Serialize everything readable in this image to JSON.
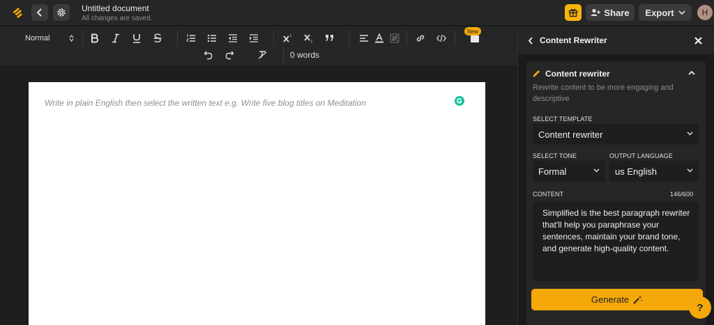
{
  "topbar": {
    "doc_title": "Untitled document",
    "doc_status": "All changes are saved.",
    "share_label": "Share",
    "export_label": "Export",
    "avatar_initial": "H"
  },
  "toolbar": {
    "style_select": "Normal",
    "new_badge": "New",
    "word_count": "0 words"
  },
  "editor": {
    "placeholder": "Write in plain English then select the written text e.g. Write five blog titles on Meditation"
  },
  "panel": {
    "header_title": "Content Rewriter",
    "card_title": "Content rewriter",
    "card_description": "Rewrite content to be more engaging and descriptive",
    "template_label": "SELECT TEMPLATE",
    "template_value": "Content rewriter",
    "tone_label": "SELECT TONE",
    "tone_value": "Formal",
    "language_label": "OUTPUT LANGUAGE",
    "language_value": "us English",
    "content_label": "CONTENT",
    "content_count": "146/600",
    "content_text": "Simplified is the best paragraph rewriter that'll help you paraphrase your sentences, maintain your brand tone, and generate high-quality content.",
    "generate_label": "Generate",
    "help_label": "?"
  },
  "colors": {
    "accent": "#f5a80a",
    "panel_bg": "#1a1a1a",
    "toolbar_bg": "#262626",
    "page_bg": "#ffffff"
  }
}
